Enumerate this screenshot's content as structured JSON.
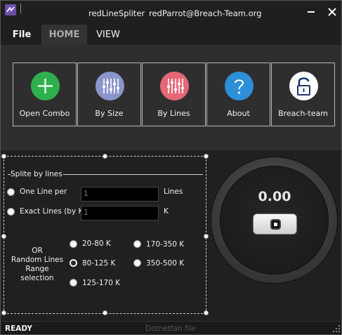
{
  "window": {
    "title": "redLineSpliter",
    "user_email": "redParrot@Breach-Team.org",
    "minimize_icon": "minimize-icon",
    "close_icon": "close-icon"
  },
  "menu": {
    "tabs": [
      {
        "label": "File"
      },
      {
        "label": "HOME"
      },
      {
        "label": "VIEW"
      }
    ]
  },
  "ribbon": {
    "buttons": [
      {
        "label": "Open Combo",
        "icon": "plus-icon",
        "color": "#2fb04e"
      },
      {
        "label": "By Size",
        "icon": "sliders-icon",
        "color": "#8a95c9"
      },
      {
        "label": "By Lines",
        "icon": "sliders-icon",
        "color": "#e56877"
      },
      {
        "label": "About",
        "icon": "question-icon",
        "color": "#2d8fd8"
      },
      {
        "label": "Breach-team",
        "icon": "lock-icon",
        "color": "#ffffff"
      }
    ]
  },
  "split_group": {
    "title": "Splite by lines",
    "one_line_per": {
      "label": "One Line per",
      "value": "1",
      "unit": "Lines"
    },
    "exact_lines": {
      "label": "Exact Lines (by K)",
      "value": "1",
      "unit": "K"
    },
    "or_text": [
      "OR",
      "Random Lines",
      "Range",
      "selection"
    ],
    "ranges": [
      {
        "label": "20-80 K",
        "selected": false
      },
      {
        "label": "170-350 K",
        "selected": false
      },
      {
        "label": "80-125 K",
        "selected": true
      },
      {
        "label": "350-500 K",
        "selected": false
      },
      {
        "label": "125-170 K",
        "selected": false
      }
    ]
  },
  "counter": {
    "value": "0.00",
    "stop_icon": "stop-icon"
  },
  "status": {
    "state": "READY",
    "file_text": "Dotnetfan file"
  }
}
